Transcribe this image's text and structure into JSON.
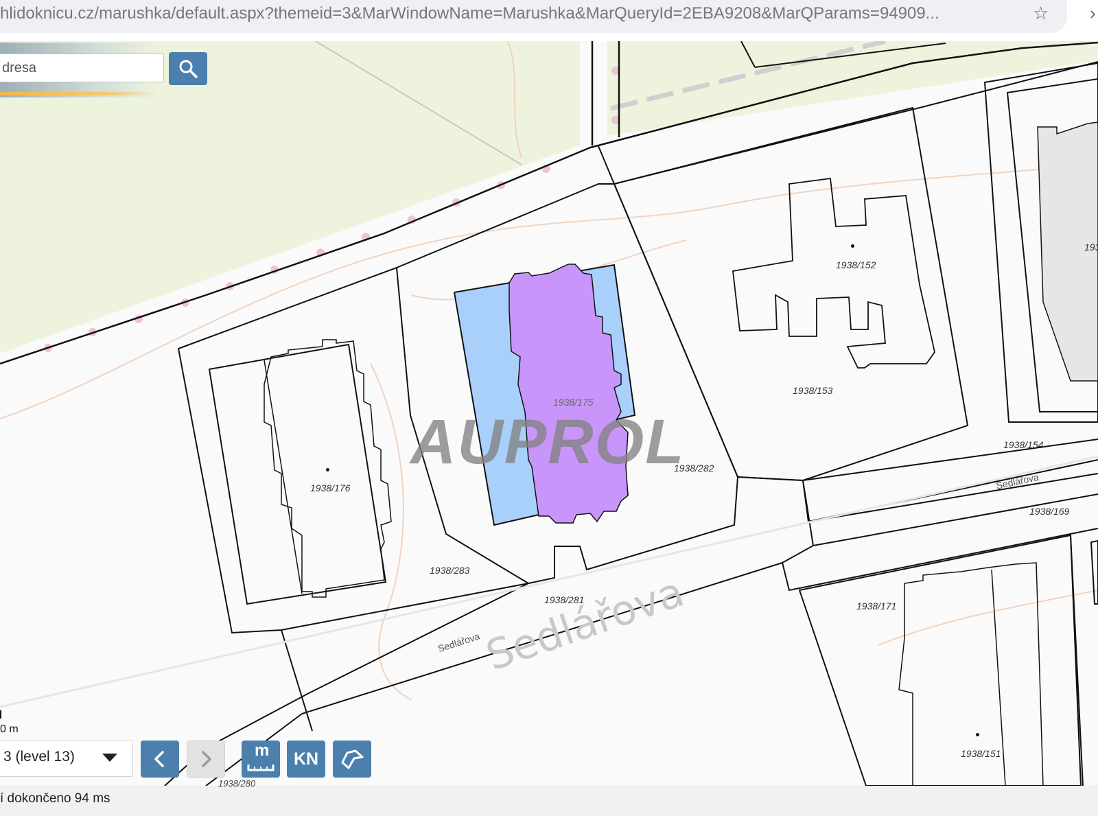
{
  "browser": {
    "url": "...hlidoknicu.cz/marushka/default.aspx?themeid=3&MarWindowName=Marushka&MarQueryId=2EBA9208&MarQParams=94909...",
    "star_icon": "star-icon"
  },
  "search": {
    "placeholder": "dresa",
    "icon": "search-icon"
  },
  "watermark": "AUPROL",
  "parcels": {
    "p176": "1938/176",
    "p175": "1938/175",
    "p152": "1938/152",
    "p153": "1938/153",
    "p282": "1938/282",
    "p283": "1938/283",
    "p281": "1938/281",
    "p154": "1938/154",
    "p169": "1938/169",
    "p171": "1938/171",
    "p151": "1938/151",
    "p280": "1938/280",
    "p19x": "193"
  },
  "streets": {
    "main_big": "Sedlářova",
    "label_left": "Sedlářova",
    "label_right": "Sedlářova"
  },
  "scale": {
    "label": "0 m"
  },
  "controls": {
    "level_select": "3 (level 13)",
    "back_icon": "chevron-left-icon",
    "forward_icon": "chevron-right-icon",
    "measure_label": "m",
    "measure_icon": "ruler-icon",
    "kn_label": "KN",
    "polygon_icon": "polygon-select-icon"
  },
  "status": {
    "text": "í dokončeno 94 ms"
  },
  "colors": {
    "building_highlight_blue": "#a8d0fa",
    "building_highlight_purple": "#c896fa",
    "park_area": "#eef3dd",
    "button_blue": "#4b7fae"
  }
}
